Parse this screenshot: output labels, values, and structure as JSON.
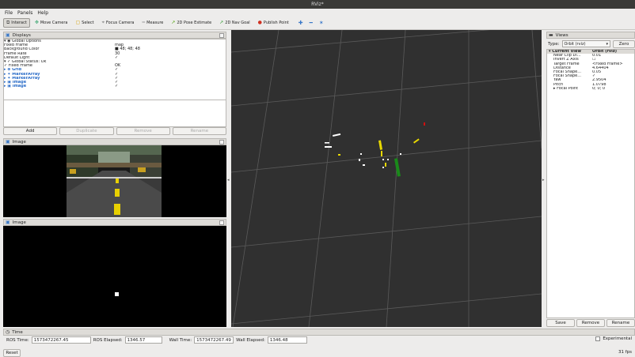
{
  "window": {
    "title": "RViz*"
  },
  "menu": [
    "File",
    "Panels",
    "Help"
  ],
  "toolbar": [
    {
      "label": "Interact",
      "icon": "interact-icon",
      "glyph": "⧉",
      "color": "#555",
      "active": true
    },
    {
      "label": "Move Camera",
      "icon": "move-camera-icon",
      "glyph": "✥",
      "color": "#4a7",
      "active": false
    },
    {
      "label": "Select",
      "icon": "select-icon",
      "glyph": "▢",
      "color": "#d6a000",
      "active": false
    },
    {
      "label": "Focus Camera",
      "icon": "focus-camera-icon",
      "glyph": "⌖",
      "color": "#777",
      "active": false
    },
    {
      "label": "Measure",
      "icon": "measure-icon",
      "glyph": "━",
      "color": "#999",
      "active": false
    },
    {
      "label": "2D Pose Estimate",
      "icon": "pose-estimate-icon",
      "glyph": "↗",
      "color": "#4aa000",
      "active": false
    },
    {
      "label": "2D Nav Goal",
      "icon": "nav-goal-icon",
      "glyph": "↗",
      "color": "#2d9a2d",
      "active": false
    },
    {
      "label": "Publish Point",
      "icon": "publish-point-icon",
      "glyph": "●",
      "color": "#d03020",
      "active": false
    }
  ],
  "toolbar_extra": [
    {
      "icon": "add-tool-icon",
      "glyph": "✚",
      "color": "#3a78c8"
    },
    {
      "icon": "remove-tool-icon",
      "glyph": "━",
      "color": "#3a78c8"
    },
    {
      "icon": "tool-properties-icon",
      "glyph": "✶",
      "color": "#3a78c8"
    }
  ],
  "displays": {
    "title": "Displays",
    "rows": [
      {
        "key": "▾  ◉ Global Options",
        "val": "",
        "cls": ""
      },
      {
        "key": "      Fixed Frame",
        "val": "map",
        "cls": ""
      },
      {
        "key": "      Background Color",
        "val": "■ 48; 48; 48",
        "cls": ""
      },
      {
        "key": "      Frame Rate",
        "val": "30",
        "cls": ""
      },
      {
        "key": "      Default Light",
        "val": "✓",
        "cls": ""
      },
      {
        "key": "▾  ✓ Global Status: Ok",
        "val": "",
        "cls": ""
      },
      {
        "key": "       ✓ Fixed Frame",
        "val": "OK",
        "cls": ""
      },
      {
        "key": "▸  ⊕ Grid",
        "val": "✓",
        "cls": "blue"
      },
      {
        "key": "▸  ✦ MarkerArray",
        "val": "✓",
        "cls": "blue"
      },
      {
        "key": "▸  ✦ MarkerArray",
        "val": "✓",
        "cls": "blue"
      },
      {
        "key": "▸  ▣ Image",
        "val": "✓",
        "cls": "blue"
      },
      {
        "key": "▸  ▣ Image",
        "val": "✓",
        "cls": "blue"
      }
    ],
    "buttons": [
      "Add",
      "Duplicate",
      "Remove",
      "Rename"
    ]
  },
  "image_panel_1": {
    "title": "Image"
  },
  "image_panel_2": {
    "title": "Image"
  },
  "views": {
    "title": "Views",
    "type_label": "Type:",
    "type_value": "Orbit (rviz)",
    "zero_label": "Zero",
    "header": {
      "key": "Current View",
      "val": "Orbit (rviz)"
    },
    "rows": [
      {
        "key": "Near Clip Di...",
        "val": "0.01"
      },
      {
        "key": "Invert Z Axis",
        "val": "☐"
      },
      {
        "key": "Target Frame",
        "val": "<Fixed Frame>"
      },
      {
        "key": "Distance",
        "val": "4.64404"
      },
      {
        "key": "Focal Shape...",
        "val": "0.05"
      },
      {
        "key": "Focal Shape...",
        "val": "✓"
      },
      {
        "key": "Yaw",
        "val": "2.9504"
      },
      {
        "key": "Pitch",
        "val": "1.0798"
      },
      {
        "key": "▸ Focal Point",
        "val": "0; 0; 0"
      }
    ],
    "buttons": [
      "Save",
      "Remove",
      "Rename"
    ]
  },
  "time": {
    "title": "Time",
    "ros_time_label": "ROS Time:",
    "ros_time": "1573472267.45",
    "ros_elapsed_label": "ROS Elapsed:",
    "ros_elapsed": "1346.57",
    "wall_time_label": "Wall Time:",
    "wall_time": "1573472267.49",
    "wall_elapsed_label": "Wall Elapsed:",
    "wall_elapsed": "1346.48",
    "experimental": "Experimental",
    "reset": "Reset",
    "fps": "31 fps"
  },
  "colors": {
    "viewport_bg": "#303030",
    "grid": "#5a5a5a",
    "marker_white": "#ffffff",
    "marker_yellow": "#e8d800",
    "marker_green": "#1a8a1a",
    "marker_red": "#d01010"
  }
}
